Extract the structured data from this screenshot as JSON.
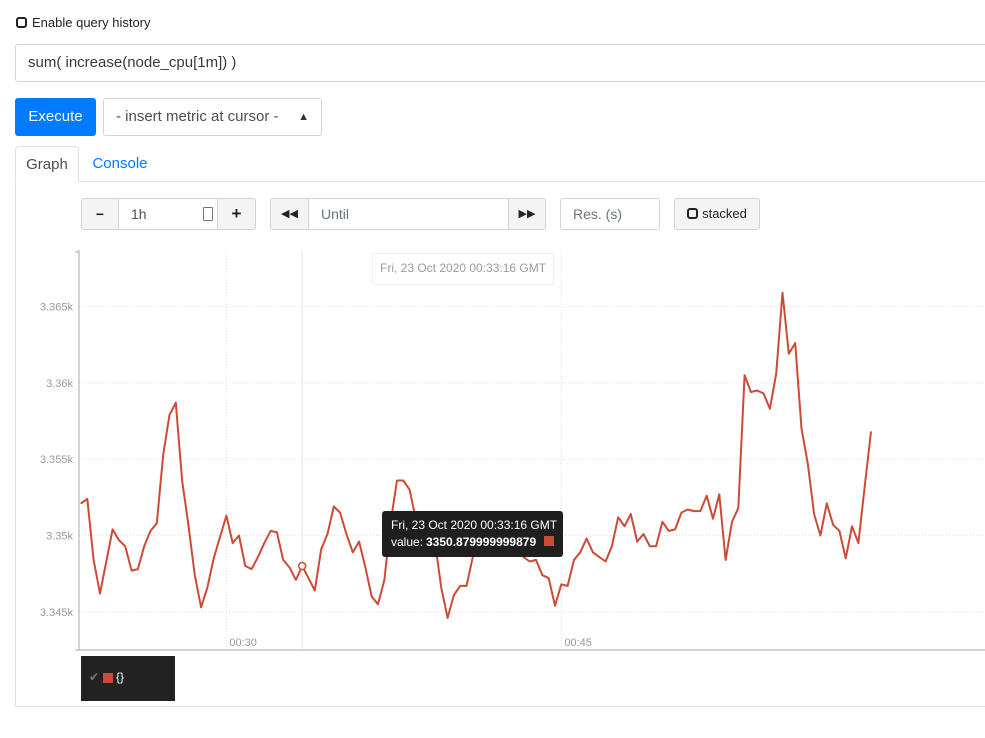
{
  "history": {
    "label": "Enable query history",
    "checked": false
  },
  "query": {
    "expression": "sum( increase(node_cpu[1m]) )"
  },
  "toolbar": {
    "execute_label": "Execute",
    "metric_select_label": "- insert metric at cursor -"
  },
  "tabs": [
    {
      "label": "Graph",
      "active": true
    },
    {
      "label": "Console",
      "active": false
    }
  ],
  "controls": {
    "range_minus": "−",
    "range_value": "1h",
    "range_plus": "+",
    "until_back": "◀◀",
    "until_placeholder": "Until",
    "until_fwd": "▶▶",
    "resolution_placeholder": "Res. (s)",
    "stacked_label": "stacked"
  },
  "hover": {
    "time_label": "Fri, 23 Oct 2020 00:33:16 GMT",
    "tooltip_time": "Fri, 23 Oct 2020 00:33:16 GMT",
    "tooltip_value_label": "value:",
    "tooltip_value": "3350.879999999879"
  },
  "legend": {
    "check": "✔",
    "label": "{}"
  },
  "colors": {
    "series": "#cc4b37",
    "accent": "#007bff"
  },
  "chart_data": {
    "type": "line",
    "x_ticks": [
      {
        "label": "00:30",
        "index": 23
      },
      {
        "label": "00:45",
        "index": 76
      }
    ],
    "y_ticks": [
      {
        "label": "3.345k",
        "value": 3345
      },
      {
        "label": "3.35k",
        "value": 3350
      },
      {
        "label": "3.355k",
        "value": 3355
      },
      {
        "label": "3.36k",
        "value": 3360
      },
      {
        "label": "3.365k",
        "value": 3365
      }
    ],
    "ylim": [
      3342.5,
      3368.7
    ],
    "grid": true,
    "hover_index": 35,
    "series": [
      {
        "values": [
          3352.1,
          3352.4,
          3348.4,
          3346.2,
          3348.3,
          3350.4,
          3349.7,
          3349.3,
          3347.7,
          3347.8,
          3349.3,
          3350.3,
          3350.8,
          3355.3,
          3357.9,
          3358.7,
          3353.6,
          3350.7,
          3347.4,
          3345.3,
          3346.6,
          3348.5,
          3349.9,
          3351.3,
          3349.5,
          3350.0,
          3348.0,
          3347.8,
          3348.6,
          3349.5,
          3350.3,
          3350.2,
          3348.4,
          3347.9,
          3347.1,
          3348.0,
          3347.2,
          3346.4,
          3349.1,
          3350.1,
          3351.9,
          3351.5,
          3350.1,
          3348.9,
          3349.6,
          3347.9,
          3346.0,
          3345.5,
          3347.1,
          3350.9,
          3353.6,
          3353.6,
          3353.0,
          3351.0,
          3350.0,
          3349.9,
          3349.6,
          3346.6,
          3344.6,
          3346.1,
          3346.7,
          3346.7,
          3348.6,
          3350.0,
          3350.5,
          3351.4,
          3349.2,
          3350.8,
          3348.7,
          3349.3,
          3348.6,
          3348.3,
          3348.4,
          3347.4,
          3347.2,
          3345.4,
          3346.8,
          3346.7,
          3348.4,
          3348.9,
          3349.8,
          3348.9,
          3348.6,
          3348.3,
          3349.3,
          3351.2,
          3350.6,
          3351.4,
          3349.6,
          3350.1,
          3349.3,
          3349.3,
          3350.9,
          3350.3,
          3350.4,
          3351.5,
          3351.7,
          3351.6,
          3351.6,
          3352.6,
          3351.1,
          3352.7,
          3348.4,
          3350.9,
          3351.8,
          3360.5,
          3359.4,
          3359.5,
          3359.3,
          3358.3,
          3360.6,
          3365.9,
          3361.9,
          3362.6,
          3357.0,
          3354.7,
          3351.4,
          3350.0,
          3352.1,
          3350.7,
          3350.3,
          3348.5,
          3350.6,
          3349.5,
          3353.2,
          3356.8
        ]
      }
    ]
  }
}
